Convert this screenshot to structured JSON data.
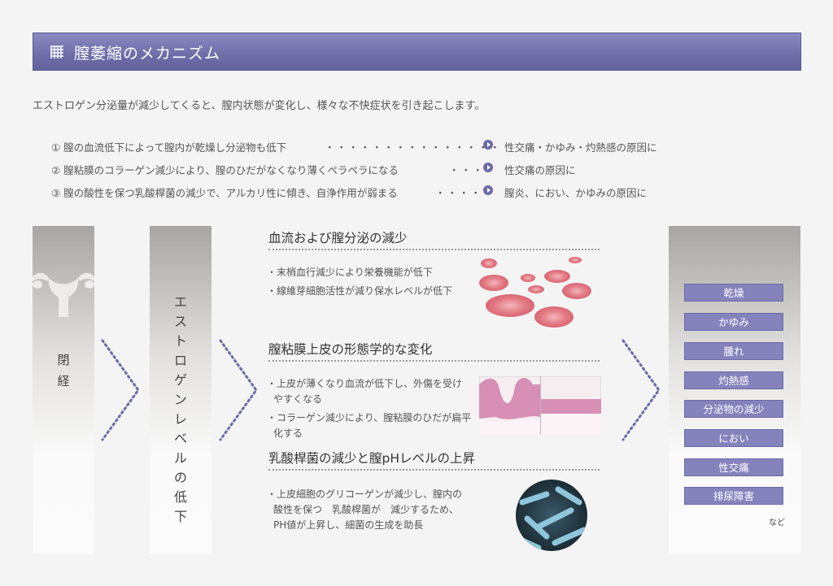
{
  "header": {
    "title": "膣萎縮のメカニズム"
  },
  "intro": "エストロゲン分泌量が減少してくると、膣内状態が変化し、様々な不快症状を引き起こします。",
  "causes": [
    {
      "text": "① 膣の血流低下によって膣内が乾燥し分泌物も低下",
      "dots": "・・・・・・・・・・・・・・・",
      "result": "性交痛・かゆみ・灼熱感の原因に"
    },
    {
      "text": "② 膣粘膜のコラーゲン減少により、膣のひだがなくなり薄くペラペラになる",
      "dots": "・・・",
      "result": "性交痛の原因に"
    },
    {
      "text": "③ 膣の酸性を保つ乳酸桿菌の減少で、アルカリ性に傾き、自浄作用が弱まる",
      "dots": "・・・・",
      "result": "膣炎、におい、かゆみの原因に"
    }
  ],
  "stage1": "閉経",
  "stage2": "エストロゲンレベルの低下",
  "sections": [
    {
      "title": "血流および膣分泌の減少",
      "bullets": [
        "・末梢血行減少により栄養機能が低下",
        "・線維芽細胞活性が減り保水レベルが低下"
      ]
    },
    {
      "title": "膣粘膜上皮の形態学的な変化",
      "bullets": [
        "・上皮が薄くなり血流が低下し、外傷を受け",
        "やすくなる",
        "・コラーゲン減少により、膣粘膜のひだが扁平",
        "化する"
      ]
    },
    {
      "title": "乳酸桿菌の減少と膣pHレベルの上昇",
      "bullets": [
        "・上皮細胞のグリコーゲンが減少し、膣内の",
        "酸性を保つ　乳酸桿菌が　減少するため、",
        "PH値が上昇し、細菌の生成を助長"
      ]
    }
  ],
  "symptoms": [
    "乾燥",
    "かゆみ",
    "腫れ",
    "灼熱感",
    "分泌物の減少",
    "におい",
    "性交痛",
    "排尿障害"
  ],
  "symptoms_note": "など",
  "colors": {
    "header": "#6e6da8",
    "accent": "#6b6aa5",
    "tag": "#8583bc",
    "dots": "#6b6aa5"
  }
}
